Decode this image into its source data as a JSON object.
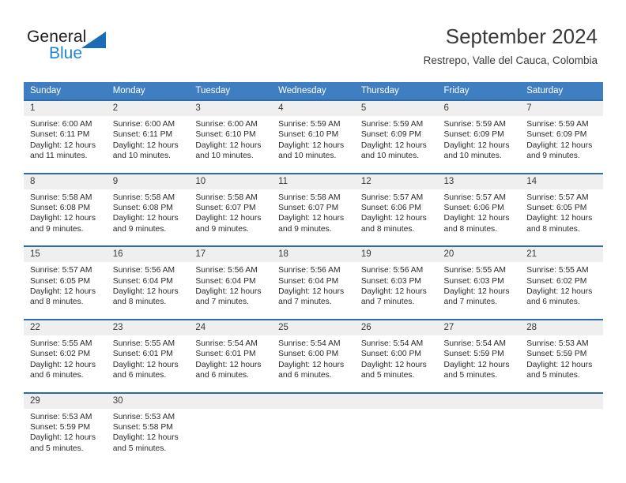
{
  "brand": {
    "name_part1": "General",
    "name_part2": "Blue",
    "accent_color": "#1e86d6",
    "triangle_color": "#1b6cb5"
  },
  "header": {
    "title": "September 2024",
    "subtitle": "Restrepo, Valle del Cauca, Colombia"
  },
  "theme": {
    "header_row_bg": "#3f7fc1",
    "cell_top_border": "#2e6ba8",
    "daynum_bg": "#efefef"
  },
  "calendar": {
    "weekday_headers": [
      "Sunday",
      "Monday",
      "Tuesday",
      "Wednesday",
      "Thursday",
      "Friday",
      "Saturday"
    ],
    "weeks": [
      [
        {
          "day": "1",
          "sunrise": "Sunrise: 6:00 AM",
          "sunset": "Sunset: 6:11 PM",
          "daylight_line1": "Daylight: 12 hours",
          "daylight_line2": "and 11 minutes."
        },
        {
          "day": "2",
          "sunrise": "Sunrise: 6:00 AM",
          "sunset": "Sunset: 6:11 PM",
          "daylight_line1": "Daylight: 12 hours",
          "daylight_line2": "and 10 minutes."
        },
        {
          "day": "3",
          "sunrise": "Sunrise: 6:00 AM",
          "sunset": "Sunset: 6:10 PM",
          "daylight_line1": "Daylight: 12 hours",
          "daylight_line2": "and 10 minutes."
        },
        {
          "day": "4",
          "sunrise": "Sunrise: 5:59 AM",
          "sunset": "Sunset: 6:10 PM",
          "daylight_line1": "Daylight: 12 hours",
          "daylight_line2": "and 10 minutes."
        },
        {
          "day": "5",
          "sunrise": "Sunrise: 5:59 AM",
          "sunset": "Sunset: 6:09 PM",
          "daylight_line1": "Daylight: 12 hours",
          "daylight_line2": "and 10 minutes."
        },
        {
          "day": "6",
          "sunrise": "Sunrise: 5:59 AM",
          "sunset": "Sunset: 6:09 PM",
          "daylight_line1": "Daylight: 12 hours",
          "daylight_line2": "and 10 minutes."
        },
        {
          "day": "7",
          "sunrise": "Sunrise: 5:59 AM",
          "sunset": "Sunset: 6:09 PM",
          "daylight_line1": "Daylight: 12 hours",
          "daylight_line2": "and 9 minutes."
        }
      ],
      [
        {
          "day": "8",
          "sunrise": "Sunrise: 5:58 AM",
          "sunset": "Sunset: 6:08 PM",
          "daylight_line1": "Daylight: 12 hours",
          "daylight_line2": "and 9 minutes."
        },
        {
          "day": "9",
          "sunrise": "Sunrise: 5:58 AM",
          "sunset": "Sunset: 6:08 PM",
          "daylight_line1": "Daylight: 12 hours",
          "daylight_line2": "and 9 minutes."
        },
        {
          "day": "10",
          "sunrise": "Sunrise: 5:58 AM",
          "sunset": "Sunset: 6:07 PM",
          "daylight_line1": "Daylight: 12 hours",
          "daylight_line2": "and 9 minutes."
        },
        {
          "day": "11",
          "sunrise": "Sunrise: 5:58 AM",
          "sunset": "Sunset: 6:07 PM",
          "daylight_line1": "Daylight: 12 hours",
          "daylight_line2": "and 9 minutes."
        },
        {
          "day": "12",
          "sunrise": "Sunrise: 5:57 AM",
          "sunset": "Sunset: 6:06 PM",
          "daylight_line1": "Daylight: 12 hours",
          "daylight_line2": "and 8 minutes."
        },
        {
          "day": "13",
          "sunrise": "Sunrise: 5:57 AM",
          "sunset": "Sunset: 6:06 PM",
          "daylight_line1": "Daylight: 12 hours",
          "daylight_line2": "and 8 minutes."
        },
        {
          "day": "14",
          "sunrise": "Sunrise: 5:57 AM",
          "sunset": "Sunset: 6:05 PM",
          "daylight_line1": "Daylight: 12 hours",
          "daylight_line2": "and 8 minutes."
        }
      ],
      [
        {
          "day": "15",
          "sunrise": "Sunrise: 5:57 AM",
          "sunset": "Sunset: 6:05 PM",
          "daylight_line1": "Daylight: 12 hours",
          "daylight_line2": "and 8 minutes."
        },
        {
          "day": "16",
          "sunrise": "Sunrise: 5:56 AM",
          "sunset": "Sunset: 6:04 PM",
          "daylight_line1": "Daylight: 12 hours",
          "daylight_line2": "and 8 minutes."
        },
        {
          "day": "17",
          "sunrise": "Sunrise: 5:56 AM",
          "sunset": "Sunset: 6:04 PM",
          "daylight_line1": "Daylight: 12 hours",
          "daylight_line2": "and 7 minutes."
        },
        {
          "day": "18",
          "sunrise": "Sunrise: 5:56 AM",
          "sunset": "Sunset: 6:04 PM",
          "daylight_line1": "Daylight: 12 hours",
          "daylight_line2": "and 7 minutes."
        },
        {
          "day": "19",
          "sunrise": "Sunrise: 5:56 AM",
          "sunset": "Sunset: 6:03 PM",
          "daylight_line1": "Daylight: 12 hours",
          "daylight_line2": "and 7 minutes."
        },
        {
          "day": "20",
          "sunrise": "Sunrise: 5:55 AM",
          "sunset": "Sunset: 6:03 PM",
          "daylight_line1": "Daylight: 12 hours",
          "daylight_line2": "and 7 minutes."
        },
        {
          "day": "21",
          "sunrise": "Sunrise: 5:55 AM",
          "sunset": "Sunset: 6:02 PM",
          "daylight_line1": "Daylight: 12 hours",
          "daylight_line2": "and 6 minutes."
        }
      ],
      [
        {
          "day": "22",
          "sunrise": "Sunrise: 5:55 AM",
          "sunset": "Sunset: 6:02 PM",
          "daylight_line1": "Daylight: 12 hours",
          "daylight_line2": "and 6 minutes."
        },
        {
          "day": "23",
          "sunrise": "Sunrise: 5:55 AM",
          "sunset": "Sunset: 6:01 PM",
          "daylight_line1": "Daylight: 12 hours",
          "daylight_line2": "and 6 minutes."
        },
        {
          "day": "24",
          "sunrise": "Sunrise: 5:54 AM",
          "sunset": "Sunset: 6:01 PM",
          "daylight_line1": "Daylight: 12 hours",
          "daylight_line2": "and 6 minutes."
        },
        {
          "day": "25",
          "sunrise": "Sunrise: 5:54 AM",
          "sunset": "Sunset: 6:00 PM",
          "daylight_line1": "Daylight: 12 hours",
          "daylight_line2": "and 6 minutes."
        },
        {
          "day": "26",
          "sunrise": "Sunrise: 5:54 AM",
          "sunset": "Sunset: 6:00 PM",
          "daylight_line1": "Daylight: 12 hours",
          "daylight_line2": "and 5 minutes."
        },
        {
          "day": "27",
          "sunrise": "Sunrise: 5:54 AM",
          "sunset": "Sunset: 5:59 PM",
          "daylight_line1": "Daylight: 12 hours",
          "daylight_line2": "and 5 minutes."
        },
        {
          "day": "28",
          "sunrise": "Sunrise: 5:53 AM",
          "sunset": "Sunset: 5:59 PM",
          "daylight_line1": "Daylight: 12 hours",
          "daylight_line2": "and 5 minutes."
        }
      ],
      [
        {
          "day": "29",
          "sunrise": "Sunrise: 5:53 AM",
          "sunset": "Sunset: 5:59 PM",
          "daylight_line1": "Daylight: 12 hours",
          "daylight_line2": "and 5 minutes."
        },
        {
          "day": "30",
          "sunrise": "Sunrise: 5:53 AM",
          "sunset": "Sunset: 5:58 PM",
          "daylight_line1": "Daylight: 12 hours",
          "daylight_line2": "and 5 minutes."
        },
        {
          "day": "",
          "sunrise": "",
          "sunset": "",
          "daylight_line1": "",
          "daylight_line2": ""
        },
        {
          "day": "",
          "sunrise": "",
          "sunset": "",
          "daylight_line1": "",
          "daylight_line2": ""
        },
        {
          "day": "",
          "sunrise": "",
          "sunset": "",
          "daylight_line1": "",
          "daylight_line2": ""
        },
        {
          "day": "",
          "sunrise": "",
          "sunset": "",
          "daylight_line1": "",
          "daylight_line2": ""
        },
        {
          "day": "",
          "sunrise": "",
          "sunset": "",
          "daylight_line1": "",
          "daylight_line2": ""
        }
      ]
    ]
  }
}
